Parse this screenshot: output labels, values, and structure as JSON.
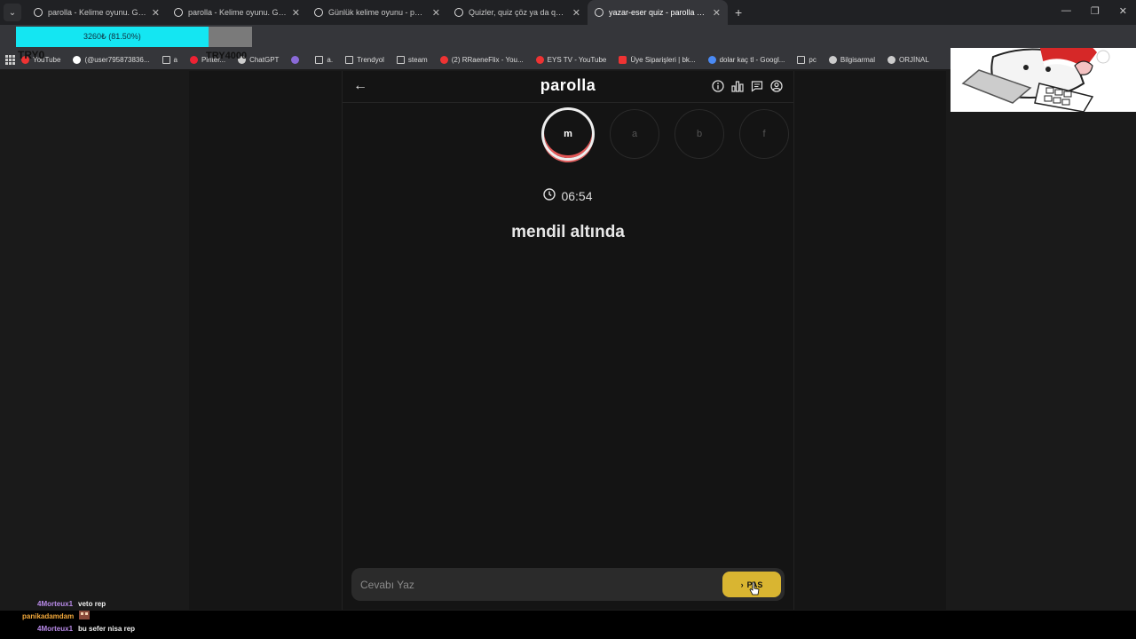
{
  "browser": {
    "tabs": [
      {
        "title": "parolla - Kelime oyunu. Günlük",
        "active": false
      },
      {
        "title": "parolla - Kelime oyunu. Günlük",
        "active": false
      },
      {
        "title": "Günlük kelime oyunu - parolla",
        "active": false
      },
      {
        "title": "Quizler, quiz çöz ya da quiz olu",
        "active": false
      },
      {
        "title": "yazar-eser quiz - parolla - Kelim",
        "active": true
      }
    ],
    "new_tab": "+",
    "bookmarks": [
      {
        "label": "YouTube",
        "icon": "youtube-icon",
        "color": "#e33"
      },
      {
        "label": "(@user795873836...",
        "icon": "tiktok-icon",
        "color": "#fff"
      },
      {
        "label": "a",
        "icon": "folder-icon",
        "color": "#ccc"
      },
      {
        "label": "Pinter...",
        "icon": "pinterest-icon",
        "color": "#e23"
      },
      {
        "label": "ChatGPT",
        "icon": "chatgpt-icon",
        "color": "#ccc"
      },
      {
        "label": "",
        "icon": "rocket-icon",
        "color": "#8a6ad8"
      },
      {
        "label": "a.",
        "icon": "folder-icon",
        "color": "#ccc"
      },
      {
        "label": "Trendyol",
        "icon": "folder-icon",
        "color": "#ccc"
      },
      {
        "label": "steam",
        "icon": "folder-icon",
        "color": "#ccc"
      },
      {
        "label": "(2) RRaeneFlix - You...",
        "icon": "youtube-icon",
        "color": "#e33"
      },
      {
        "label": "EYS TV - YouTube",
        "icon": "youtube-icon",
        "color": "#e33"
      },
      {
        "label": "Üye Siparişleri | bk...",
        "icon": "bookmark-icon",
        "color": "#e33"
      },
      {
        "label": "dolar kaç tl - Googl...",
        "icon": "google-icon",
        "color": "#4a8af4"
      },
      {
        "label": "pc",
        "icon": "folder-icon",
        "color": "#ccc"
      },
      {
        "label": "Bilgisarmal",
        "icon": "globe-icon",
        "color": "#ccc"
      },
      {
        "label": "ORJİNAL",
        "icon": "globe-icon",
        "color": "#ccc"
      }
    ]
  },
  "overlay": {
    "progress_text": "3260₺ (81.50%)",
    "progress_fraction": 0.815,
    "try_label": "TRY0",
    "goal_label": "TRY4000"
  },
  "app": {
    "logo": "parolla",
    "letters": [
      {
        "letter": "m",
        "state": "active"
      },
      {
        "letter": "a",
        "state": "pending"
      },
      {
        "letter": "b",
        "state": "pending"
      },
      {
        "letter": "f",
        "state": "pending"
      }
    ],
    "timer": "06:54",
    "clue": "mendil altında",
    "answer_placeholder": "Cevabı Yaz",
    "pass_button": "PAS"
  },
  "chat": [
    {
      "user": "4Morteux1",
      "message": "veto rep",
      "color": "#b88ae8"
    },
    {
      "user": "panikadamdam",
      "message": "",
      "color": "#f2a83a"
    },
    {
      "user": "4Morteux1",
      "message": "bu sefer nisa rep",
      "color": "#b88ae8"
    }
  ]
}
